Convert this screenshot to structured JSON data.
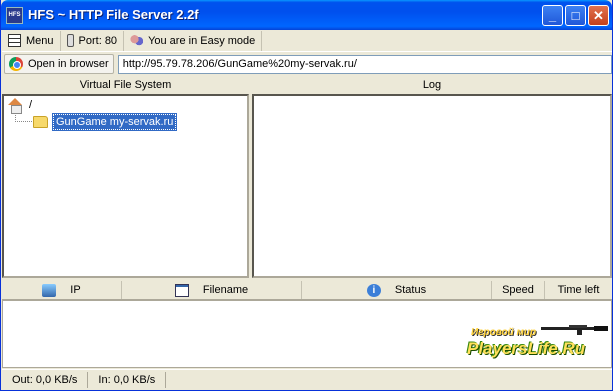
{
  "window": {
    "title": "HFS ~ HTTP File Server 2.2f",
    "icon_text": "HFS",
    "buttons": [
      "_",
      "□",
      "✕"
    ]
  },
  "toolbar": {
    "menu_label": "Menu",
    "port_label": "Port: 80",
    "mode_label": "You are in Easy mode"
  },
  "urlbar": {
    "open_label": "Open in browser",
    "url": "http://95.79.78.206/GunGame%20my-servak.ru/"
  },
  "panes": {
    "vfs_title": "Virtual File System",
    "log_title": "Log"
  },
  "vfs": {
    "root_label": "/",
    "items": [
      {
        "label": "GunGame my-servak.ru",
        "selected": true
      }
    ]
  },
  "connections": {
    "columns": [
      "IP",
      "Filename",
      "Status",
      "Speed",
      "Time left"
    ]
  },
  "statusbar": {
    "out": "Out: 0,0 KB/s",
    "in": "In: 0,0 KB/s"
  },
  "watermark": {
    "top": "Игровой мир",
    "main": "PlayersLife.Ru"
  },
  "colors": {
    "titlebar": "#0053ee",
    "selection": "#316ac5",
    "face": "#ece9d8"
  }
}
